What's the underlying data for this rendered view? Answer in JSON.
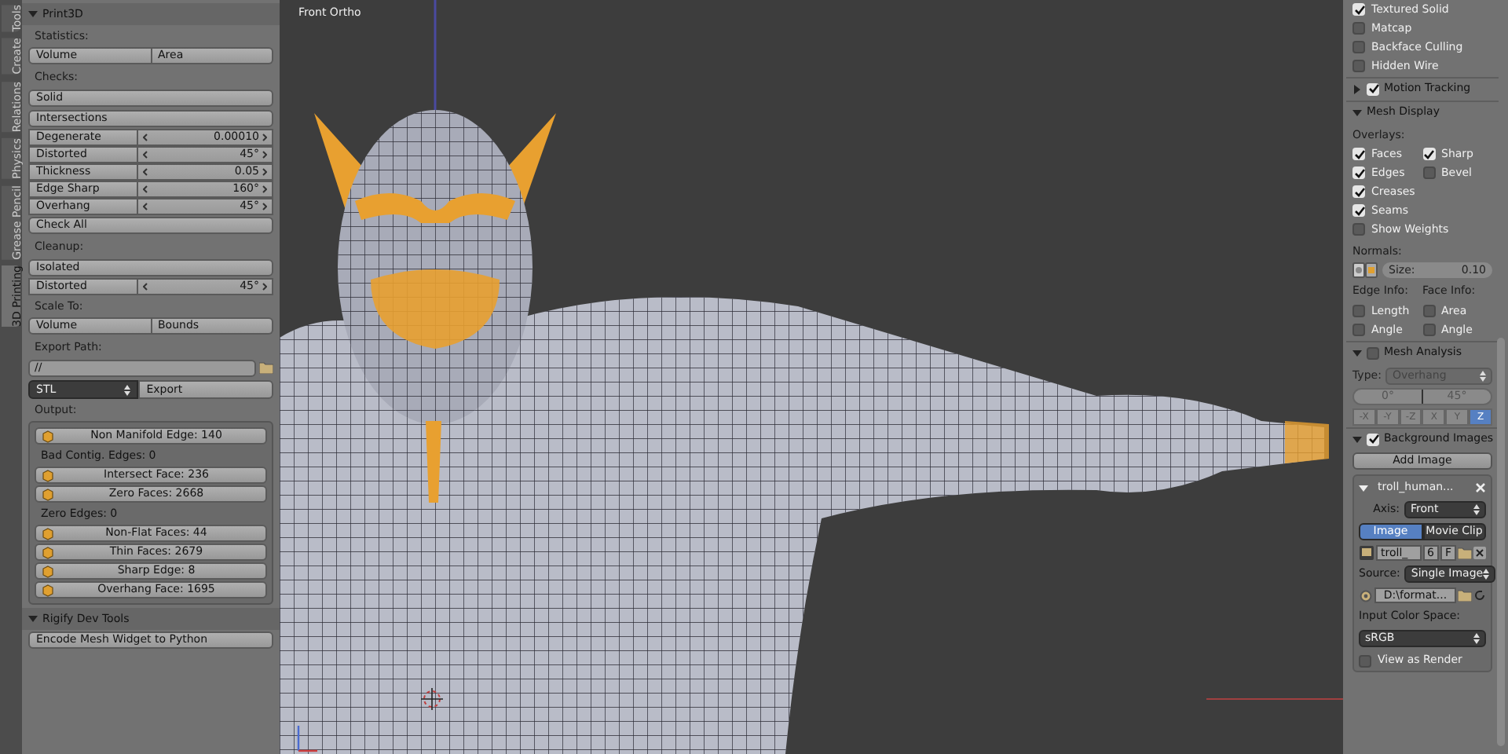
{
  "viewport": {
    "title": "Front Ortho"
  },
  "tool_tabs": [
    {
      "label": "Tools",
      "selected": false
    },
    {
      "label": "Create",
      "selected": false
    },
    {
      "label": "Relations",
      "selected": false
    },
    {
      "label": "Physics",
      "selected": false
    },
    {
      "label": "Grease Pencil",
      "selected": false
    },
    {
      "label": "3D Printing",
      "selected": true
    }
  ],
  "left_panel": {
    "items": [
      {
        "kind": "panel_header",
        "label": "Print3D",
        "expanded": true
      },
      {
        "kind": "heading",
        "label": "Statistics:"
      },
      {
        "kind": "pair",
        "labels": [
          "Volume",
          "Area"
        ]
      },
      {
        "kind": "heading",
        "label": "Checks:"
      },
      {
        "kind": "button",
        "label": "Solid"
      },
      {
        "kind": "button",
        "label": "Intersections"
      },
      {
        "kind": "value",
        "label": "Degenerate",
        "value": "0.00010"
      },
      {
        "kind": "value",
        "label": "Distorted",
        "value": "45°"
      },
      {
        "kind": "value",
        "label": "Thickness",
        "value": "0.05"
      },
      {
        "kind": "value",
        "label": "Edge Sharp",
        "value": "160°"
      },
      {
        "kind": "value",
        "label": "Overhang",
        "value": "45°"
      },
      {
        "kind": "button",
        "label": "Check All"
      },
      {
        "kind": "heading",
        "label": "Cleanup:"
      },
      {
        "kind": "button",
        "label": "Isolated"
      },
      {
        "kind": "value",
        "label": "Distorted",
        "value": "45°"
      },
      {
        "kind": "heading",
        "label": "Scale To:"
      },
      {
        "kind": "pair",
        "labels": [
          "Volume",
          "Bounds"
        ]
      },
      {
        "kind": "heading",
        "label": "Export Path:"
      },
      {
        "kind": "path",
        "value": "//"
      },
      {
        "kind": "export",
        "format": "STL",
        "button": "Export"
      },
      {
        "kind": "heading",
        "label": "Output:"
      },
      {
        "kind": "output",
        "rows": [
          {
            "kind": "button",
            "label": "Non Manifold Edge: 140"
          },
          {
            "kind": "text",
            "label": "Bad Contig. Edges: 0"
          },
          {
            "kind": "button",
            "label": "Intersect Face: 236"
          },
          {
            "kind": "button",
            "label": "Zero Faces: 2668"
          },
          {
            "kind": "text",
            "label": "Zero Edges: 0"
          },
          {
            "kind": "button",
            "label": "Non-Flat Faces: 44"
          },
          {
            "kind": "button",
            "label": "Thin Faces: 2679"
          },
          {
            "kind": "button",
            "label": "Sharp Edge: 8"
          },
          {
            "kind": "button",
            "label": "Overhang Face: 1695"
          }
        ]
      },
      {
        "kind": "panel_header",
        "label": "Rigify Dev Tools",
        "expanded": true
      },
      {
        "kind": "button",
        "label": "Encode Mesh Widget to Python"
      }
    ]
  },
  "right_panel": {
    "items": [
      {
        "kind": "check",
        "label": "Textured Solid",
        "checked": true
      },
      {
        "kind": "check",
        "label": "Matcap",
        "checked": false
      },
      {
        "kind": "check",
        "label": "Backface Culling",
        "checked": false
      },
      {
        "kind": "check",
        "label": "Hidden Wire",
        "checked": false
      },
      {
        "kind": "panel_header",
        "label": "Motion Tracking",
        "expanded": false,
        "checked": true
      },
      {
        "kind": "panel_header",
        "label": "Mesh Display",
        "expanded": true
      },
      {
        "kind": "heading",
        "label": "Overlays:"
      },
      {
        "kind": "check_pair",
        "items": [
          {
            "label": "Faces",
            "checked": true
          },
          {
            "label": "Sharp",
            "checked": true
          }
        ]
      },
      {
        "kind": "check_pair",
        "items": [
          {
            "label": "Edges",
            "checked": true
          },
          {
            "label": "Bevel",
            "checked": false
          }
        ]
      },
      {
        "kind": "check",
        "label": "Creases",
        "checked": true
      },
      {
        "kind": "check",
        "label": "Seams",
        "checked": true
      },
      {
        "kind": "check",
        "label": "Show Weights",
        "checked": false
      },
      {
        "kind": "heading",
        "label": "Normals:"
      },
      {
        "kind": "normals",
        "label": "Size:",
        "value": "0.10"
      },
      {
        "kind": "heading_pair",
        "labels": [
          "Edge Info:",
          "Face Info:"
        ]
      },
      {
        "kind": "check_pair",
        "items": [
          {
            "label": "Length",
            "checked": false
          },
          {
            "label": "Area",
            "checked": false
          }
        ]
      },
      {
        "kind": "check_pair",
        "items": [
          {
            "label": "Angle",
            "checked": false
          },
          {
            "label": "Angle",
            "checked": false
          }
        ]
      },
      {
        "kind": "panel_header",
        "label": "Mesh Analysis",
        "expanded": true,
        "checked": false
      },
      {
        "kind": "select",
        "label": "Type:",
        "value": "Overhang"
      },
      {
        "kind": "range",
        "values": [
          "0°",
          "45°"
        ]
      },
      {
        "kind": "axis",
        "buttons": [
          {
            "label": "-X",
            "selected": false
          },
          {
            "label": "-Y",
            "selected": false
          },
          {
            "label": "-Z",
            "selected": false
          },
          {
            "label": "X",
            "selected": false
          },
          {
            "label": "Y",
            "selected": false
          },
          {
            "label": "Z",
            "selected": true
          }
        ]
      },
      {
        "kind": "panel_header",
        "label": "Background Images",
        "expanded": true,
        "checked": true
      },
      {
        "kind": "button",
        "label": "Add Image"
      },
      {
        "kind": "image_box",
        "name": "troll_human...",
        "axis_label": "Axis:",
        "axis": "Front",
        "tabs": [
          {
            "label": "Image",
            "selected": true
          },
          {
            "label": "Movie Clip",
            "selected": false
          }
        ],
        "datablock": [
          "troll_",
          "6",
          "F"
        ],
        "source_label": "Source:",
        "source": "Single Image",
        "path": "D:\\format...",
        "color_space_label": "Input Color Space:",
        "color_space": "sRGB",
        "view_as_render": {
          "label": "View as Render",
          "checked": false
        }
      }
    ]
  }
}
